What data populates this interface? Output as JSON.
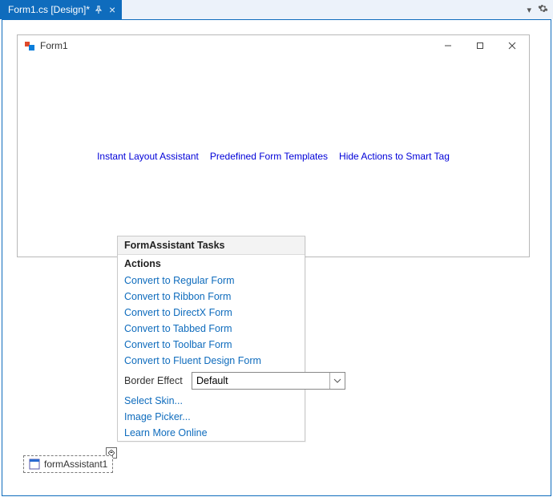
{
  "tab": {
    "title": "Form1.cs [Design]*"
  },
  "form": {
    "title": "Form1",
    "links": {
      "layout": "Instant Layout Assistant",
      "templates": "Predefined Form Templates",
      "hide": "Hide Actions to Smart Tag"
    }
  },
  "tray": {
    "item": "formAssistant1"
  },
  "smarttag": {
    "header": "FormAssistant Tasks",
    "section": "Actions",
    "actions": {
      "regular": "Convert to Regular Form",
      "ribbon": "Convert to Ribbon Form",
      "directx": "Convert to DirectX Form",
      "tabbed": "Convert to Tabbed Form",
      "toolbar": "Convert to Toolbar Form",
      "fluent": "Convert to Fluent Design Form"
    },
    "borderEffect": {
      "label": "Border Effect",
      "value": "Default"
    },
    "extras": {
      "skin": "Select Skin...",
      "image": "Image Picker...",
      "learn": "Learn More Online"
    }
  }
}
